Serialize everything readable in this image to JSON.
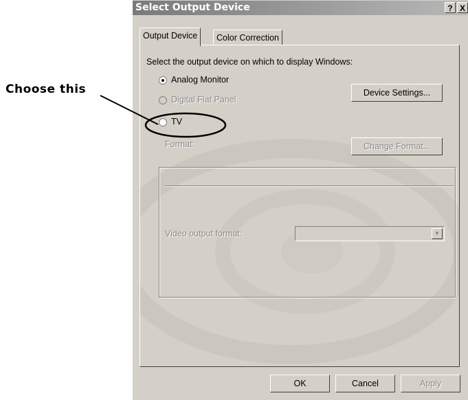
{
  "annotation": {
    "label": "Choose this"
  },
  "window": {
    "title": "Select Output Device",
    "help_button": "?",
    "close_button": "X"
  },
  "tabs": [
    {
      "label": "Output Device",
      "selected": true
    },
    {
      "label": "Color Correction",
      "selected": false
    }
  ],
  "panel": {
    "instruction": "Select the output device on which to display Windows:",
    "devices": [
      {
        "label": "Analog Monitor",
        "selected": true,
        "enabled": true
      },
      {
        "label": "Digital Flat Panel",
        "selected": false,
        "enabled": false
      },
      {
        "label": "TV",
        "selected": false,
        "enabled": true
      }
    ],
    "device_settings_button": "Device Settings...",
    "format_label": "Format:",
    "change_format_button": "Change Format...",
    "video_output_label": "Video output format:",
    "video_output_value": ""
  },
  "footer": {
    "ok": "OK",
    "cancel": "Cancel",
    "apply": "Apply"
  },
  "colors": {
    "dialog_face": "#d4d0c8",
    "titlebar_start": "#7a7a7a",
    "titlebar_end": "#b8b8b8",
    "disabled_text": "#888888"
  }
}
